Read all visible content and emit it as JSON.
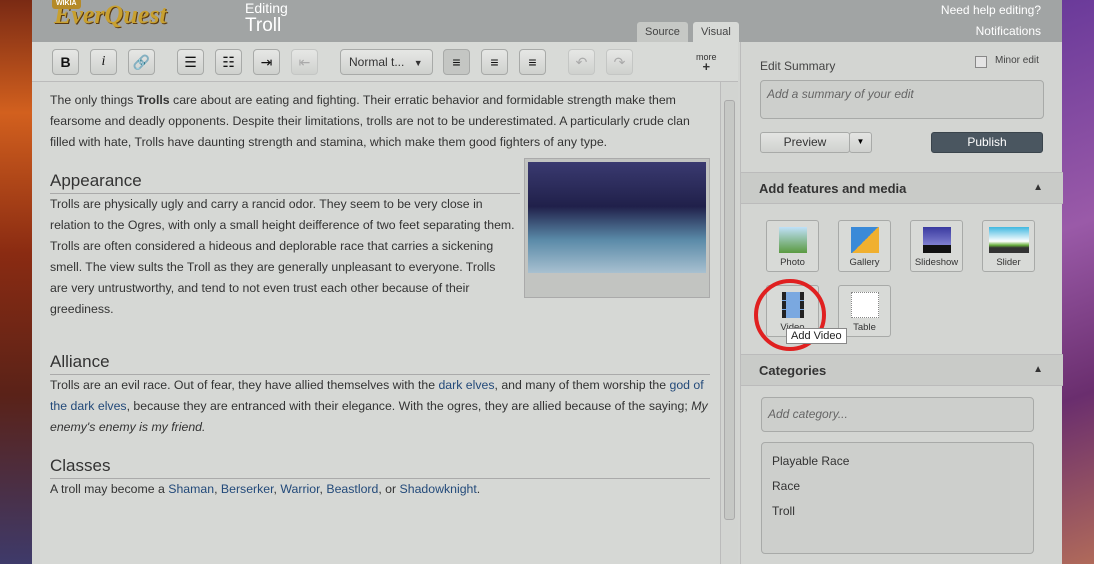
{
  "header": {
    "wikia": "WIKIA",
    "logo": "EverQuest",
    "editing": "Editing",
    "title": "Troll",
    "help": "Need help editing?",
    "notifications": "Notifications",
    "tabs": [
      "Source",
      "Visual"
    ]
  },
  "toolbar": {
    "bold": "B",
    "italic": "i",
    "format": "Normal t...",
    "more": "more"
  },
  "article": {
    "intro_a": "The only things ",
    "intro_b": "Trolls",
    "intro_c": " care about are eating and fighting. Their erratic behavior and formidable strength make them fearsome and deadly opponents. Despite their limitations, trolls are not to be underestimated. A particularly crude clan filled with hate, Trolls have daunting strength and stamina, which make them good fighters of any type.",
    "h_appearance": "Appearance",
    "appearance": "Trolls are physically ugly and carry a rancid odor. They seem to be very close in relation to the Ogres, with only a small height deifference of two feet separating them. Trolls are often considered a hideous and deplorable race that carries a sickening smell. The view sults the Troll as they are generally unpleasant to everyone. Trolls are very untrustworthy, and tend to not even trust each other because of their greediness.",
    "h_alliance": "Alliance",
    "al_a": "Trolls are an evil race. Out of fear, they have allied themselves with the ",
    "al_link1": "dark elves",
    "al_b": ", and many of them worship the ",
    "al_link2": "god of the dark elves",
    "al_c": ", because they are entranced with their elegance. With the ogres, they are allied because of the saying; ",
    "al_quote": "My enemy's enemy is my friend.",
    "h_classes": "Classes",
    "cl_a": "A troll may become a ",
    "classes": [
      "Shaman",
      "Berserker",
      "Warrior",
      "Beastlord",
      "Shadowknight"
    ],
    "sep": ", ",
    "or": ", or ",
    "end": "."
  },
  "panel": {
    "edit_summary": "Edit Summary",
    "minor_edit": "Minor edit",
    "summary_placeholder": "Add a summary of your edit",
    "preview": "Preview",
    "publish": "Publish",
    "features_title": "Add features and media",
    "features": [
      "Photo",
      "Gallery",
      "Slideshow",
      "Slider",
      "Video",
      "Table"
    ],
    "tooltip": "Add Video",
    "categories_title": "Categories",
    "category_placeholder": "Add category...",
    "categories": [
      "Playable Race",
      "Race",
      "Troll"
    ]
  }
}
